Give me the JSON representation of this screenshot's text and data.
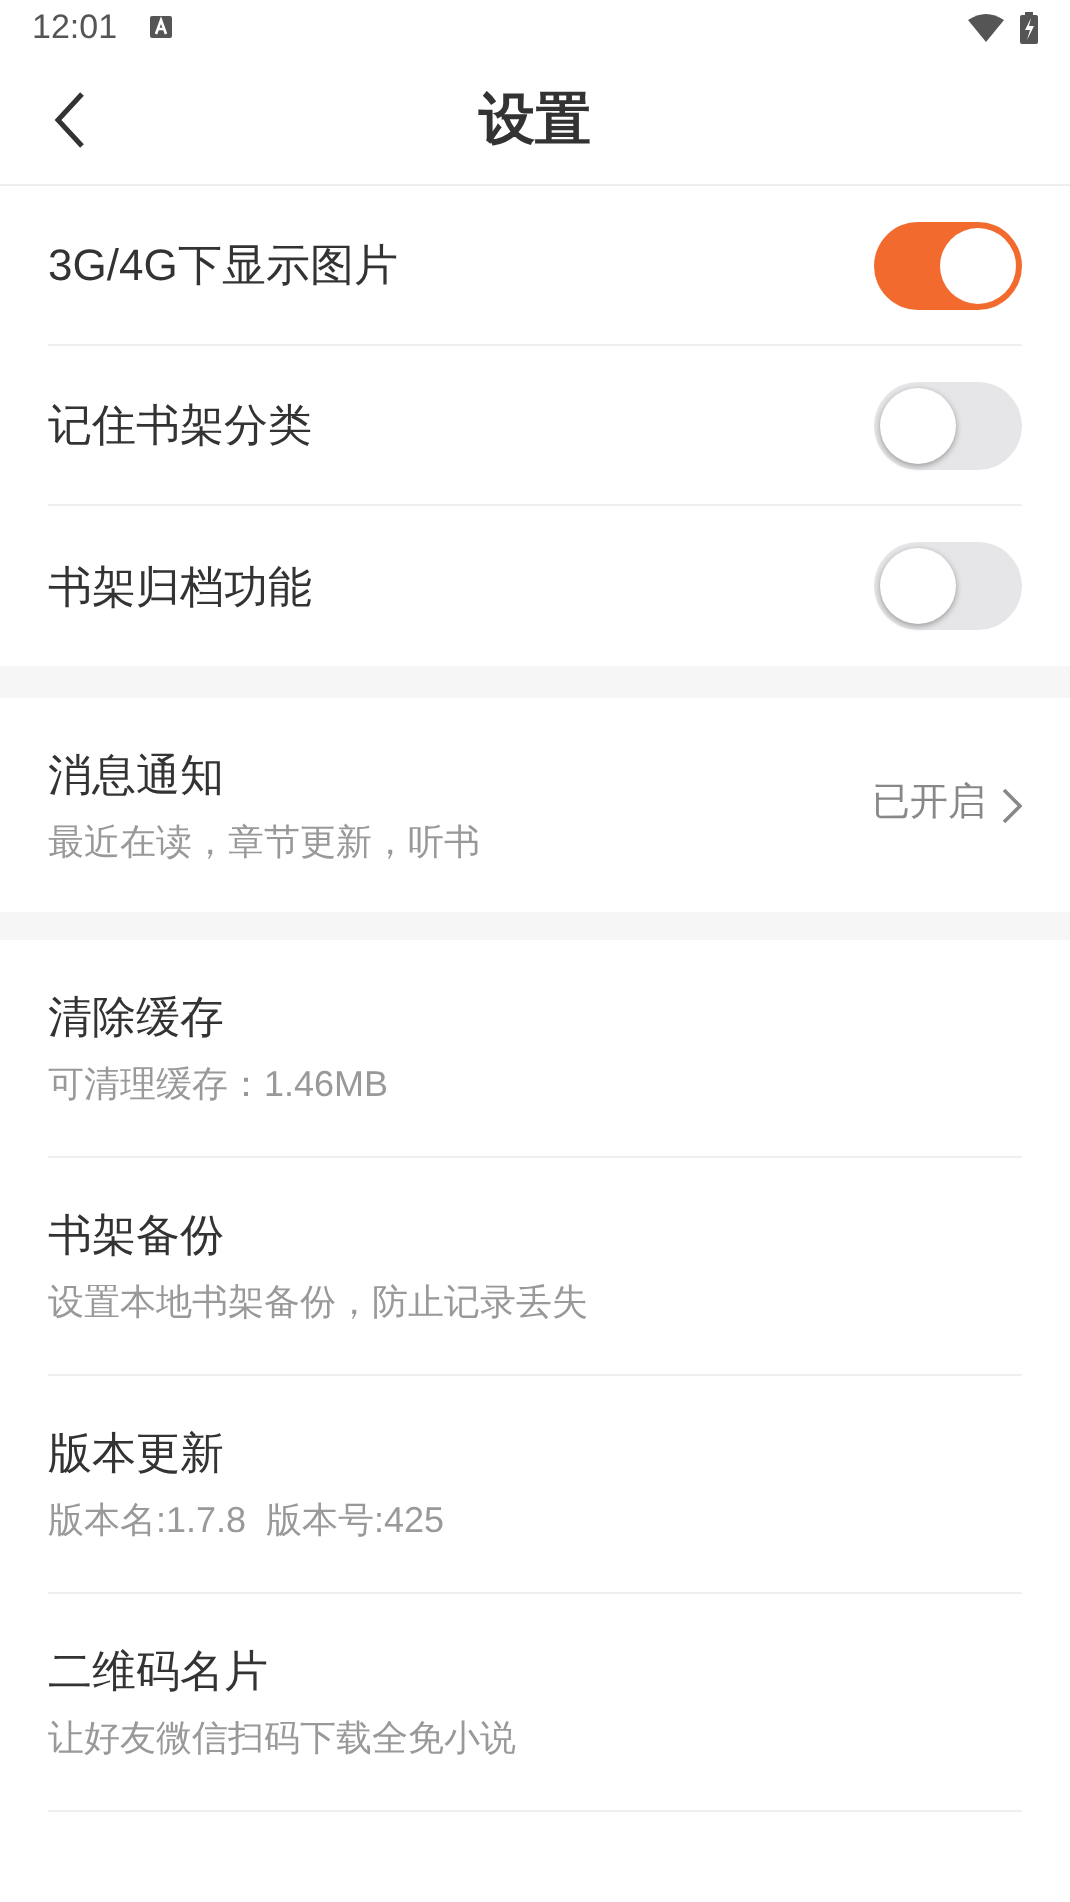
{
  "status_bar": {
    "time": "12:01"
  },
  "header": {
    "title": "设置"
  },
  "toggles": [
    {
      "label": "3G/4G下显示图片",
      "on": true
    },
    {
      "label": "记住书架分类",
      "on": false
    },
    {
      "label": "书架归档功能",
      "on": false
    }
  ],
  "notification": {
    "title": "消息通知",
    "subtitle": "最近在读，章节更新，听书",
    "value": "已开启"
  },
  "items": [
    {
      "title": "清除缓存",
      "subtitle": "可清理缓存：1.46MB"
    },
    {
      "title": "书架备份",
      "subtitle": "设置本地书架备份，防止记录丢失"
    },
    {
      "title": "版本更新",
      "subtitle": "版本名:1.7.8  版本号:425"
    },
    {
      "title": "二维码名片",
      "subtitle": "让好友微信扫码下载全免小说"
    }
  ]
}
